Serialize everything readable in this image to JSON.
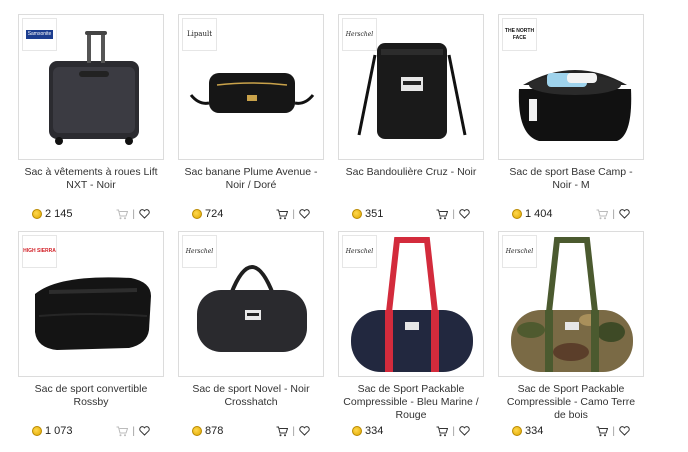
{
  "products": [
    {
      "title": "Sac à vêtements à roues Lift NXT - Noir",
      "price": "2 145",
      "brand": "Samsonite",
      "cart_disabled": true
    },
    {
      "title": "Sac banane Plume Avenue - Noir / Doré",
      "price": "724",
      "brand": "Lipault",
      "cart_disabled": false
    },
    {
      "title": "Sac Bandoulière Cruz - Noir",
      "price": "351",
      "brand": "Herschel",
      "cart_disabled": false
    },
    {
      "title": "Sac de sport Base Camp - Noir - M",
      "price": "1 404",
      "brand": "THE NORTH FACE",
      "cart_disabled": true
    },
    {
      "title": "Sac de sport convertible Rossby",
      "price": "1 073",
      "brand": "HIGH SIERRA",
      "cart_disabled": true
    },
    {
      "title": "Sac de sport Novel - Noir Crosshatch",
      "price": "878",
      "brand": "Herschel",
      "cart_disabled": false
    },
    {
      "title": "Sac de Sport Packable Compressible - Bleu Marine / Rouge",
      "price": "334",
      "brand": "Herschel",
      "cart_disabled": false
    },
    {
      "title": "Sac de Sport Packable Compressible - Camo Terre de bois",
      "price": "334",
      "brand": "Herschel",
      "cart_disabled": false
    }
  ],
  "colors": {
    "coin": "#f2c200",
    "border": "#dcdcdc",
    "text": "#333333",
    "icon_active": "#333333",
    "icon_disabled": "#bbbbbb"
  }
}
